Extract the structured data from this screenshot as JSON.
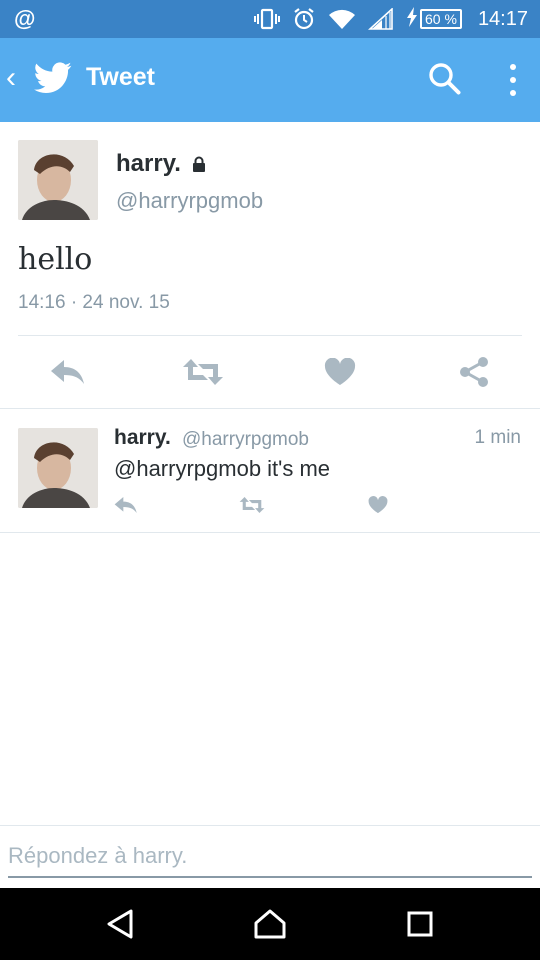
{
  "status_bar": {
    "left_icon": "@",
    "icons": [
      "vibrate-icon",
      "alarm-icon",
      "wifi-icon",
      "signal-icon",
      "charging-icon"
    ],
    "battery": "60 %",
    "time": "14:17"
  },
  "app_bar": {
    "title": "Tweet",
    "icons": [
      "back-icon",
      "twitter-bird-icon",
      "search-icon",
      "more-vertical-icon"
    ],
    "color": "#55acee"
  },
  "tweet": {
    "author_name": "harry.",
    "author_handle": "@harryrpgmob",
    "protected_icon": "lock-icon",
    "text": "hello",
    "timestamp": "14:16 · 24 nov. 15",
    "actions": [
      "reply-icon",
      "retweet-icon",
      "like-icon",
      "share-icon"
    ]
  },
  "reply": {
    "author_name": "harry.",
    "author_handle": "@harryrpgmob",
    "time": "1 min",
    "text": "@harryrpgmob it's me",
    "actions": [
      "reply-icon",
      "retweet-icon",
      "like-icon"
    ]
  },
  "composer": {
    "placeholder": "Répondez à harry.",
    "value": ""
  },
  "nav_bar": {
    "icons": [
      "nav-back-icon",
      "nav-home-icon",
      "nav-recents-icon"
    ]
  },
  "colors": {
    "status_bar": "#3a83c6",
    "accent": "#55acee",
    "secondary_text": "#8899a6",
    "icon_gray": "#aab8c2"
  }
}
